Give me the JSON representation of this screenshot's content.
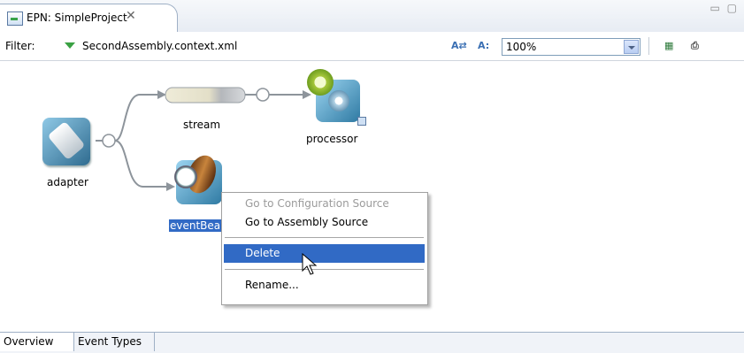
{
  "editor_tab": {
    "title": "EPN: SimpleProject",
    "close_icon": "close-icon"
  },
  "filter_bar": {
    "label": "Filter:",
    "value": "SecondAssembly.context.xml",
    "zoom_value": "100%"
  },
  "nodes": {
    "adapter": "adapter",
    "stream": "stream",
    "processor": "processor",
    "event_bean": "eventBea"
  },
  "context_menu": {
    "items": [
      {
        "label": "Go to Configuration Source",
        "state": "disabled"
      },
      {
        "label": "Go to Assembly Source",
        "state": "enabled"
      },
      {
        "label": "Delete",
        "state": "highlighted"
      },
      {
        "label": "Rename...",
        "state": "enabled"
      }
    ]
  },
  "bottom_tabs": [
    {
      "label": "Overview",
      "active": true
    },
    {
      "label": "Event Types",
      "active": false
    }
  ],
  "colors": {
    "selection": "#316ac5",
    "filter_arrow": "#3aa143",
    "tab_border": "#9fb0c6"
  }
}
